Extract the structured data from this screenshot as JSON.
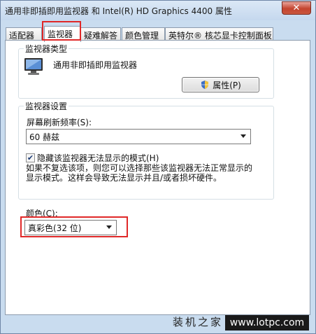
{
  "window": {
    "title": "通用非即插即用监视器 和 Intel(R) HD Graphics 4400 属性",
    "close_glyph": "✕"
  },
  "tabs": [
    {
      "label": "适配器"
    },
    {
      "label": "监视器",
      "active": true
    },
    {
      "label": "疑难解答"
    },
    {
      "label": "颜色管理"
    },
    {
      "label": "英特尔® 核芯显卡控制面板"
    }
  ],
  "monitor_type": {
    "group_label": "监视器类型",
    "name": "通用非即插即用监视器",
    "icon": "monitor-icon",
    "properties_button": "属性(P)"
  },
  "monitor_settings": {
    "group_label": "监视器设置",
    "refresh_label": "屏幕刷新频率(S):",
    "refresh_value": "60 赫兹",
    "hide_modes_checked": true,
    "hide_modes_label": "隐藏该监视器无法显示的模式(H)",
    "description": "如果不复选该项，则您可以选择那些该监视器无法正常显示的显示模式。这样会导致无法显示并且/或者损坏硬件。"
  },
  "color": {
    "label": "颜色(C):",
    "value": "真彩色(32 位)"
  },
  "watermark": {
    "text": "装机之家",
    "url": "www.lotpc.com"
  },
  "colors": {
    "highlight": "#e02828",
    "window_frame": "#c9dcef"
  }
}
